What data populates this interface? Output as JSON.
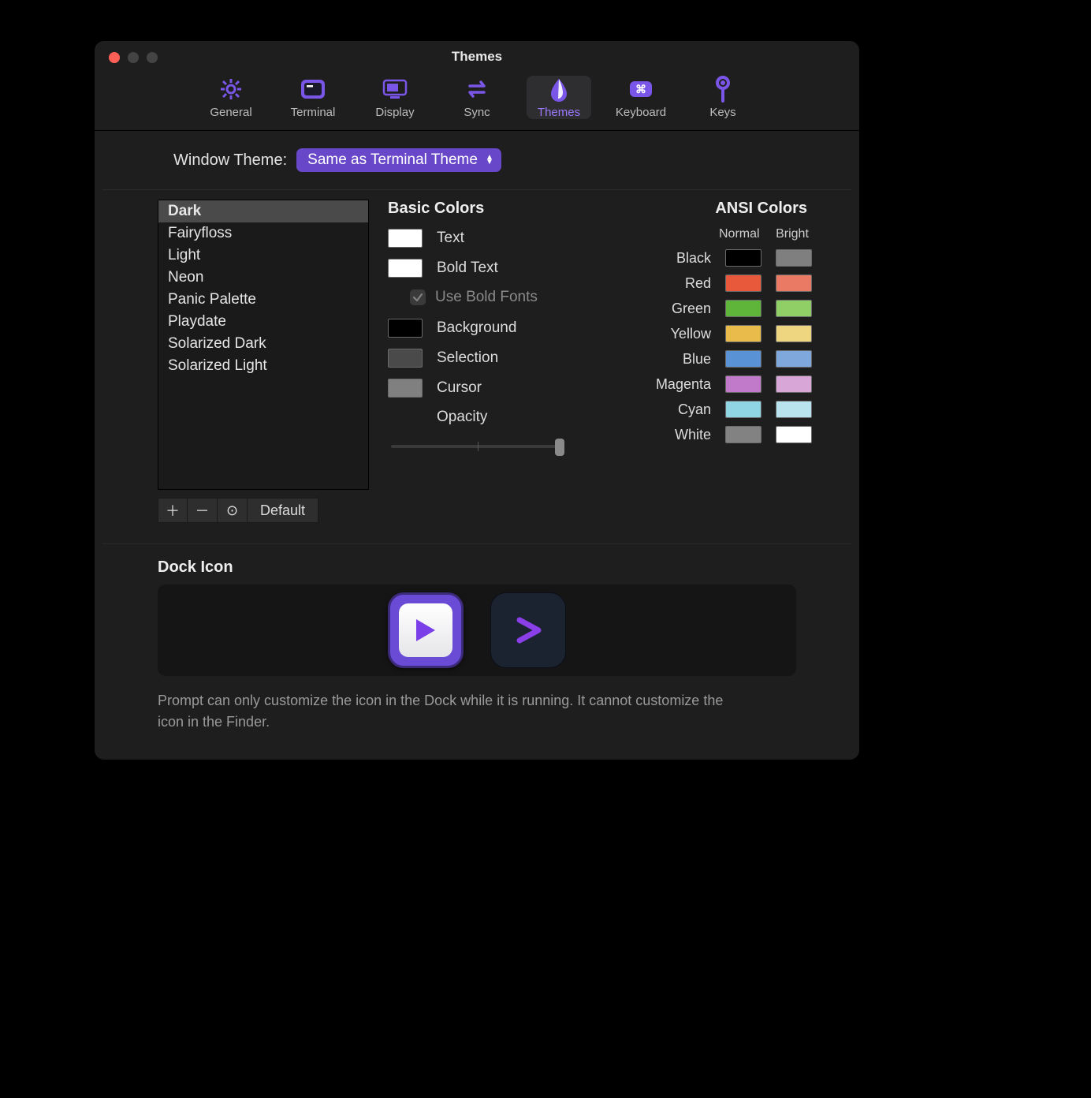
{
  "window": {
    "title": "Themes"
  },
  "toolbar": {
    "items": [
      {
        "label": "General"
      },
      {
        "label": "Terminal"
      },
      {
        "label": "Display"
      },
      {
        "label": "Sync"
      },
      {
        "label": "Themes"
      },
      {
        "label": "Keyboard"
      },
      {
        "label": "Keys"
      }
    ],
    "active_index": 4
  },
  "window_theme": {
    "label": "Window Theme:",
    "selected": "Same as Terminal Theme"
  },
  "themes": {
    "items": [
      "Dark",
      "Fairyfloss",
      "Light",
      "Neon",
      "Panic Palette",
      "Playdate",
      "Solarized Dark",
      "Solarized Light"
    ],
    "selected_index": 0,
    "actions": {
      "add": "＋",
      "remove": "－",
      "more": "⊙",
      "default": "Default"
    }
  },
  "basic_colors": {
    "heading": "Basic Colors",
    "rows": [
      {
        "key": "text",
        "label": "Text",
        "color": "#ffffff"
      },
      {
        "key": "bold_text",
        "label": "Bold Text",
        "color": "#ffffff"
      }
    ],
    "use_bold_fonts": {
      "label": "Use Bold Fonts",
      "checked": true
    },
    "rows2": [
      {
        "key": "background",
        "label": "Background",
        "color": "#000000"
      },
      {
        "key": "selection",
        "label": "Selection",
        "color": "#4a4a4a"
      },
      {
        "key": "cursor",
        "label": "Cursor",
        "color": "#808080"
      }
    ],
    "opacity": {
      "label": "Opacity",
      "value": 1.0
    }
  },
  "ansi": {
    "heading": "ANSI Colors",
    "columns": [
      "Normal",
      "Bright"
    ],
    "rows": [
      {
        "label": "Black",
        "normal": "#000000",
        "bright": "#7f7f7f"
      },
      {
        "label": "Red",
        "normal": "#e8593c",
        "bright": "#ea7a64"
      },
      {
        "label": "Green",
        "normal": "#5fb53a",
        "bright": "#8fcf66"
      },
      {
        "label": "Yellow",
        "normal": "#e8bb4a",
        "bright": "#eed680"
      },
      {
        "label": "Blue",
        "normal": "#5a92d6",
        "bright": "#7fa9dc"
      },
      {
        "label": "Magenta",
        "normal": "#c07ac9",
        "bright": "#d9a6d8"
      },
      {
        "label": "Cyan",
        "normal": "#8fd5e3",
        "bright": "#b9e3ed"
      },
      {
        "label": "White",
        "normal": "#828282",
        "bright": "#ffffff"
      }
    ]
  },
  "dock": {
    "heading": "Dock Icon",
    "note": "Prompt can only customize the icon in the Dock while it is running. It cannot customize the icon in the Finder."
  },
  "colors": {
    "accent": "#7a56e8"
  }
}
